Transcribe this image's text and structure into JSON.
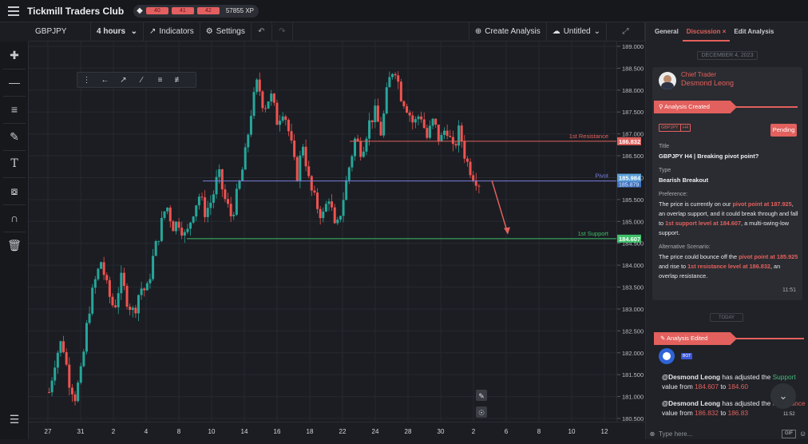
{
  "app": {
    "brand": "Tickmill Traders Club",
    "xp_segments": [
      "40",
      "41",
      "42"
    ],
    "xp_total": "57855 XP"
  },
  "toolbar": {
    "symbol": "GBPJPY",
    "interval": "4 hours",
    "indicators": "Indicators",
    "settings": "Settings",
    "create_analysis": "Create Analysis",
    "layout_name": "Untitled"
  },
  "chart_data": {
    "type": "candlestick",
    "symbol": "GBPJPY",
    "interval": "4 hours",
    "price_ticks": [
      "189.000",
      "188.500",
      "188.000",
      "187.500",
      "187.000",
      "186.500",
      "186.000",
      "185.500",
      "185.000",
      "184.500",
      "184.000",
      "183.500",
      "183.000",
      "182.500",
      "182.000",
      "181.500",
      "181.000",
      "180.500"
    ],
    "time_ticks": [
      "27",
      "31",
      "2",
      "4",
      "8",
      "10",
      "14",
      "16",
      "18",
      "22",
      "24",
      "28",
      "30",
      "2",
      "6",
      "8",
      "10",
      "12"
    ],
    "ylim": [
      180.45,
      189.05
    ],
    "levels": [
      {
        "name": "1st Resistance",
        "price": 186.832,
        "label": "186.832",
        "color": "#e2605d"
      },
      {
        "name": "Pivot",
        "price": 185.925,
        "label": "185.984",
        "label2": "185.879",
        "color": "#7b7fe0"
      },
      {
        "name": "1st Support",
        "price": 184.607,
        "label": "184.607",
        "color": "#3fbf6a"
      }
    ],
    "projection": {
      "from_price": 185.9,
      "to_price": 184.65,
      "color": "#e2605d"
    },
    "path": [
      181.1,
      181.9,
      182.3,
      181.4,
      181.0,
      181.6,
      182.9,
      183.6,
      184.1,
      183.4,
      183.0,
      183.7,
      183.2,
      182.9,
      183.5,
      183.4,
      184.2,
      184.8,
      185.4,
      184.9,
      185.0,
      184.6,
      185.2,
      185.6,
      185.2,
      185.5,
      186.1,
      185.5,
      185.1,
      185.7,
      186.4,
      187.5,
      188.2,
      187.6,
      187.9,
      187.3,
      187.6,
      186.9,
      186.0,
      186.8,
      185.8,
      185.4,
      185.1,
      185.6,
      184.7,
      185.4,
      186.2,
      186.9,
      186.6,
      187.2,
      187.5,
      187.0,
      188.1,
      188.6,
      187.9,
      187.6,
      187.2,
      187.5,
      186.9,
      187.3,
      186.8,
      187.2,
      186.6,
      187.1,
      186.4,
      186.1,
      185.9
    ]
  },
  "right": {
    "tabs": [
      "General",
      "Discussion",
      "Edit Analysis"
    ],
    "date": "DECEMBER 4, 2023",
    "author_role": "Chief Trader",
    "author_name": "Desmond Leong",
    "created_banner": "Analysis Created",
    "tag1": "GBPJPY",
    "tag2": "H4",
    "status": "Pending",
    "title_label": "Title",
    "title_value": "GBPJPY H4 | Breaking pivot point?",
    "type_label": "Type",
    "type_value": "Bearish Breakout",
    "pref_label": "Preference:",
    "pref_1": "The price is currently on our ",
    "pref_hl1": "pivot point at 187.925",
    "pref_2": ", an overlap support, and it could break through and fall to ",
    "pref_hl2": "1st support level at 184.607",
    "pref_3": ", a multi-swing-low support.",
    "alt_label": "Alternative Scenario:",
    "alt_1": "The price could bounce off the ",
    "alt_hl1": "pivot point at 185.925",
    "alt_2": " and rise to ",
    "alt_hl2": "1st resistance level at 186.832",
    "alt_3": ", an overlap resistance.",
    "card_time": "11:51",
    "today": "TODAY",
    "edited_banner": "Analysis Edited",
    "bot_tag": "BOT",
    "msg1_user": "@Desmond Leong",
    "msg1_a": " has adjusted the ",
    "msg1_field": "Support",
    "msg1_b": " value from ",
    "msg1_from": "184.607",
    "msg1_c": " to ",
    "msg1_to": "184.60",
    "msg2_user": "@Desmond Leong",
    "msg2_a": " has adjusted the ",
    "msg2_field": "Resistance",
    "msg2_b": " value from ",
    "msg2_from": "186.832",
    "msg2_c": " to ",
    "msg2_to": "186.83",
    "msg_time": "11:52",
    "input_placeholder": "Type here...",
    "gif": "GIF"
  }
}
